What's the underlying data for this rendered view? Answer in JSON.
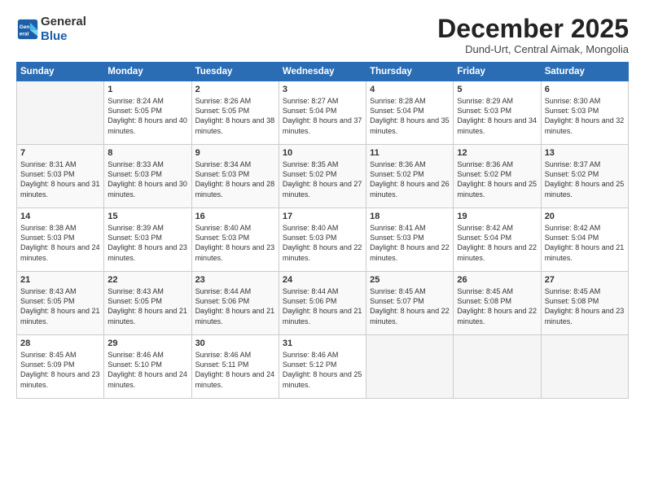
{
  "header": {
    "logo_line1": "General",
    "logo_line2": "Blue",
    "month": "December 2025",
    "location": "Dund-Urt, Central Aimak, Mongolia"
  },
  "weekdays": [
    "Sunday",
    "Monday",
    "Tuesday",
    "Wednesday",
    "Thursday",
    "Friday",
    "Saturday"
  ],
  "weeks": [
    [
      {
        "day": "",
        "sunrise": "",
        "sunset": "",
        "daylight": ""
      },
      {
        "day": "1",
        "sunrise": "Sunrise: 8:24 AM",
        "sunset": "Sunset: 5:05 PM",
        "daylight": "Daylight: 8 hours and 40 minutes."
      },
      {
        "day": "2",
        "sunrise": "Sunrise: 8:26 AM",
        "sunset": "Sunset: 5:05 PM",
        "daylight": "Daylight: 8 hours and 38 minutes."
      },
      {
        "day": "3",
        "sunrise": "Sunrise: 8:27 AM",
        "sunset": "Sunset: 5:04 PM",
        "daylight": "Daylight: 8 hours and 37 minutes."
      },
      {
        "day": "4",
        "sunrise": "Sunrise: 8:28 AM",
        "sunset": "Sunset: 5:04 PM",
        "daylight": "Daylight: 8 hours and 35 minutes."
      },
      {
        "day": "5",
        "sunrise": "Sunrise: 8:29 AM",
        "sunset": "Sunset: 5:03 PM",
        "daylight": "Daylight: 8 hours and 34 minutes."
      },
      {
        "day": "6",
        "sunrise": "Sunrise: 8:30 AM",
        "sunset": "Sunset: 5:03 PM",
        "daylight": "Daylight: 8 hours and 32 minutes."
      }
    ],
    [
      {
        "day": "7",
        "sunrise": "Sunrise: 8:31 AM",
        "sunset": "Sunset: 5:03 PM",
        "daylight": "Daylight: 8 hours and 31 minutes."
      },
      {
        "day": "8",
        "sunrise": "Sunrise: 8:33 AM",
        "sunset": "Sunset: 5:03 PM",
        "daylight": "Daylight: 8 hours and 30 minutes."
      },
      {
        "day": "9",
        "sunrise": "Sunrise: 8:34 AM",
        "sunset": "Sunset: 5:03 PM",
        "daylight": "Daylight: 8 hours and 28 minutes."
      },
      {
        "day": "10",
        "sunrise": "Sunrise: 8:35 AM",
        "sunset": "Sunset: 5:02 PM",
        "daylight": "Daylight: 8 hours and 27 minutes."
      },
      {
        "day": "11",
        "sunrise": "Sunrise: 8:36 AM",
        "sunset": "Sunset: 5:02 PM",
        "daylight": "Daylight: 8 hours and 26 minutes."
      },
      {
        "day": "12",
        "sunrise": "Sunrise: 8:36 AM",
        "sunset": "Sunset: 5:02 PM",
        "daylight": "Daylight: 8 hours and 25 minutes."
      },
      {
        "day": "13",
        "sunrise": "Sunrise: 8:37 AM",
        "sunset": "Sunset: 5:02 PM",
        "daylight": "Daylight: 8 hours and 25 minutes."
      }
    ],
    [
      {
        "day": "14",
        "sunrise": "Sunrise: 8:38 AM",
        "sunset": "Sunset: 5:03 PM",
        "daylight": "Daylight: 8 hours and 24 minutes."
      },
      {
        "day": "15",
        "sunrise": "Sunrise: 8:39 AM",
        "sunset": "Sunset: 5:03 PM",
        "daylight": "Daylight: 8 hours and 23 minutes."
      },
      {
        "day": "16",
        "sunrise": "Sunrise: 8:40 AM",
        "sunset": "Sunset: 5:03 PM",
        "daylight": "Daylight: 8 hours and 23 minutes."
      },
      {
        "day": "17",
        "sunrise": "Sunrise: 8:40 AM",
        "sunset": "Sunset: 5:03 PM",
        "daylight": "Daylight: 8 hours and 22 minutes."
      },
      {
        "day": "18",
        "sunrise": "Sunrise: 8:41 AM",
        "sunset": "Sunset: 5:03 PM",
        "daylight": "Daylight: 8 hours and 22 minutes."
      },
      {
        "day": "19",
        "sunrise": "Sunrise: 8:42 AM",
        "sunset": "Sunset: 5:04 PM",
        "daylight": "Daylight: 8 hours and 22 minutes."
      },
      {
        "day": "20",
        "sunrise": "Sunrise: 8:42 AM",
        "sunset": "Sunset: 5:04 PM",
        "daylight": "Daylight: 8 hours and 21 minutes."
      }
    ],
    [
      {
        "day": "21",
        "sunrise": "Sunrise: 8:43 AM",
        "sunset": "Sunset: 5:05 PM",
        "daylight": "Daylight: 8 hours and 21 minutes."
      },
      {
        "day": "22",
        "sunrise": "Sunrise: 8:43 AM",
        "sunset": "Sunset: 5:05 PM",
        "daylight": "Daylight: 8 hours and 21 minutes."
      },
      {
        "day": "23",
        "sunrise": "Sunrise: 8:44 AM",
        "sunset": "Sunset: 5:06 PM",
        "daylight": "Daylight: 8 hours and 21 minutes."
      },
      {
        "day": "24",
        "sunrise": "Sunrise: 8:44 AM",
        "sunset": "Sunset: 5:06 PM",
        "daylight": "Daylight: 8 hours and 21 minutes."
      },
      {
        "day": "25",
        "sunrise": "Sunrise: 8:45 AM",
        "sunset": "Sunset: 5:07 PM",
        "daylight": "Daylight: 8 hours and 22 minutes."
      },
      {
        "day": "26",
        "sunrise": "Sunrise: 8:45 AM",
        "sunset": "Sunset: 5:08 PM",
        "daylight": "Daylight: 8 hours and 22 minutes."
      },
      {
        "day": "27",
        "sunrise": "Sunrise: 8:45 AM",
        "sunset": "Sunset: 5:08 PM",
        "daylight": "Daylight: 8 hours and 23 minutes."
      }
    ],
    [
      {
        "day": "28",
        "sunrise": "Sunrise: 8:45 AM",
        "sunset": "Sunset: 5:09 PM",
        "daylight": "Daylight: 8 hours and 23 minutes."
      },
      {
        "day": "29",
        "sunrise": "Sunrise: 8:46 AM",
        "sunset": "Sunset: 5:10 PM",
        "daylight": "Daylight: 8 hours and 24 minutes."
      },
      {
        "day": "30",
        "sunrise": "Sunrise: 8:46 AM",
        "sunset": "Sunset: 5:11 PM",
        "daylight": "Daylight: 8 hours and 24 minutes."
      },
      {
        "day": "31",
        "sunrise": "Sunrise: 8:46 AM",
        "sunset": "Sunset: 5:12 PM",
        "daylight": "Daylight: 8 hours and 25 minutes."
      },
      {
        "day": "",
        "sunrise": "",
        "sunset": "",
        "daylight": ""
      },
      {
        "day": "",
        "sunrise": "",
        "sunset": "",
        "daylight": ""
      },
      {
        "day": "",
        "sunrise": "",
        "sunset": "",
        "daylight": ""
      }
    ]
  ]
}
